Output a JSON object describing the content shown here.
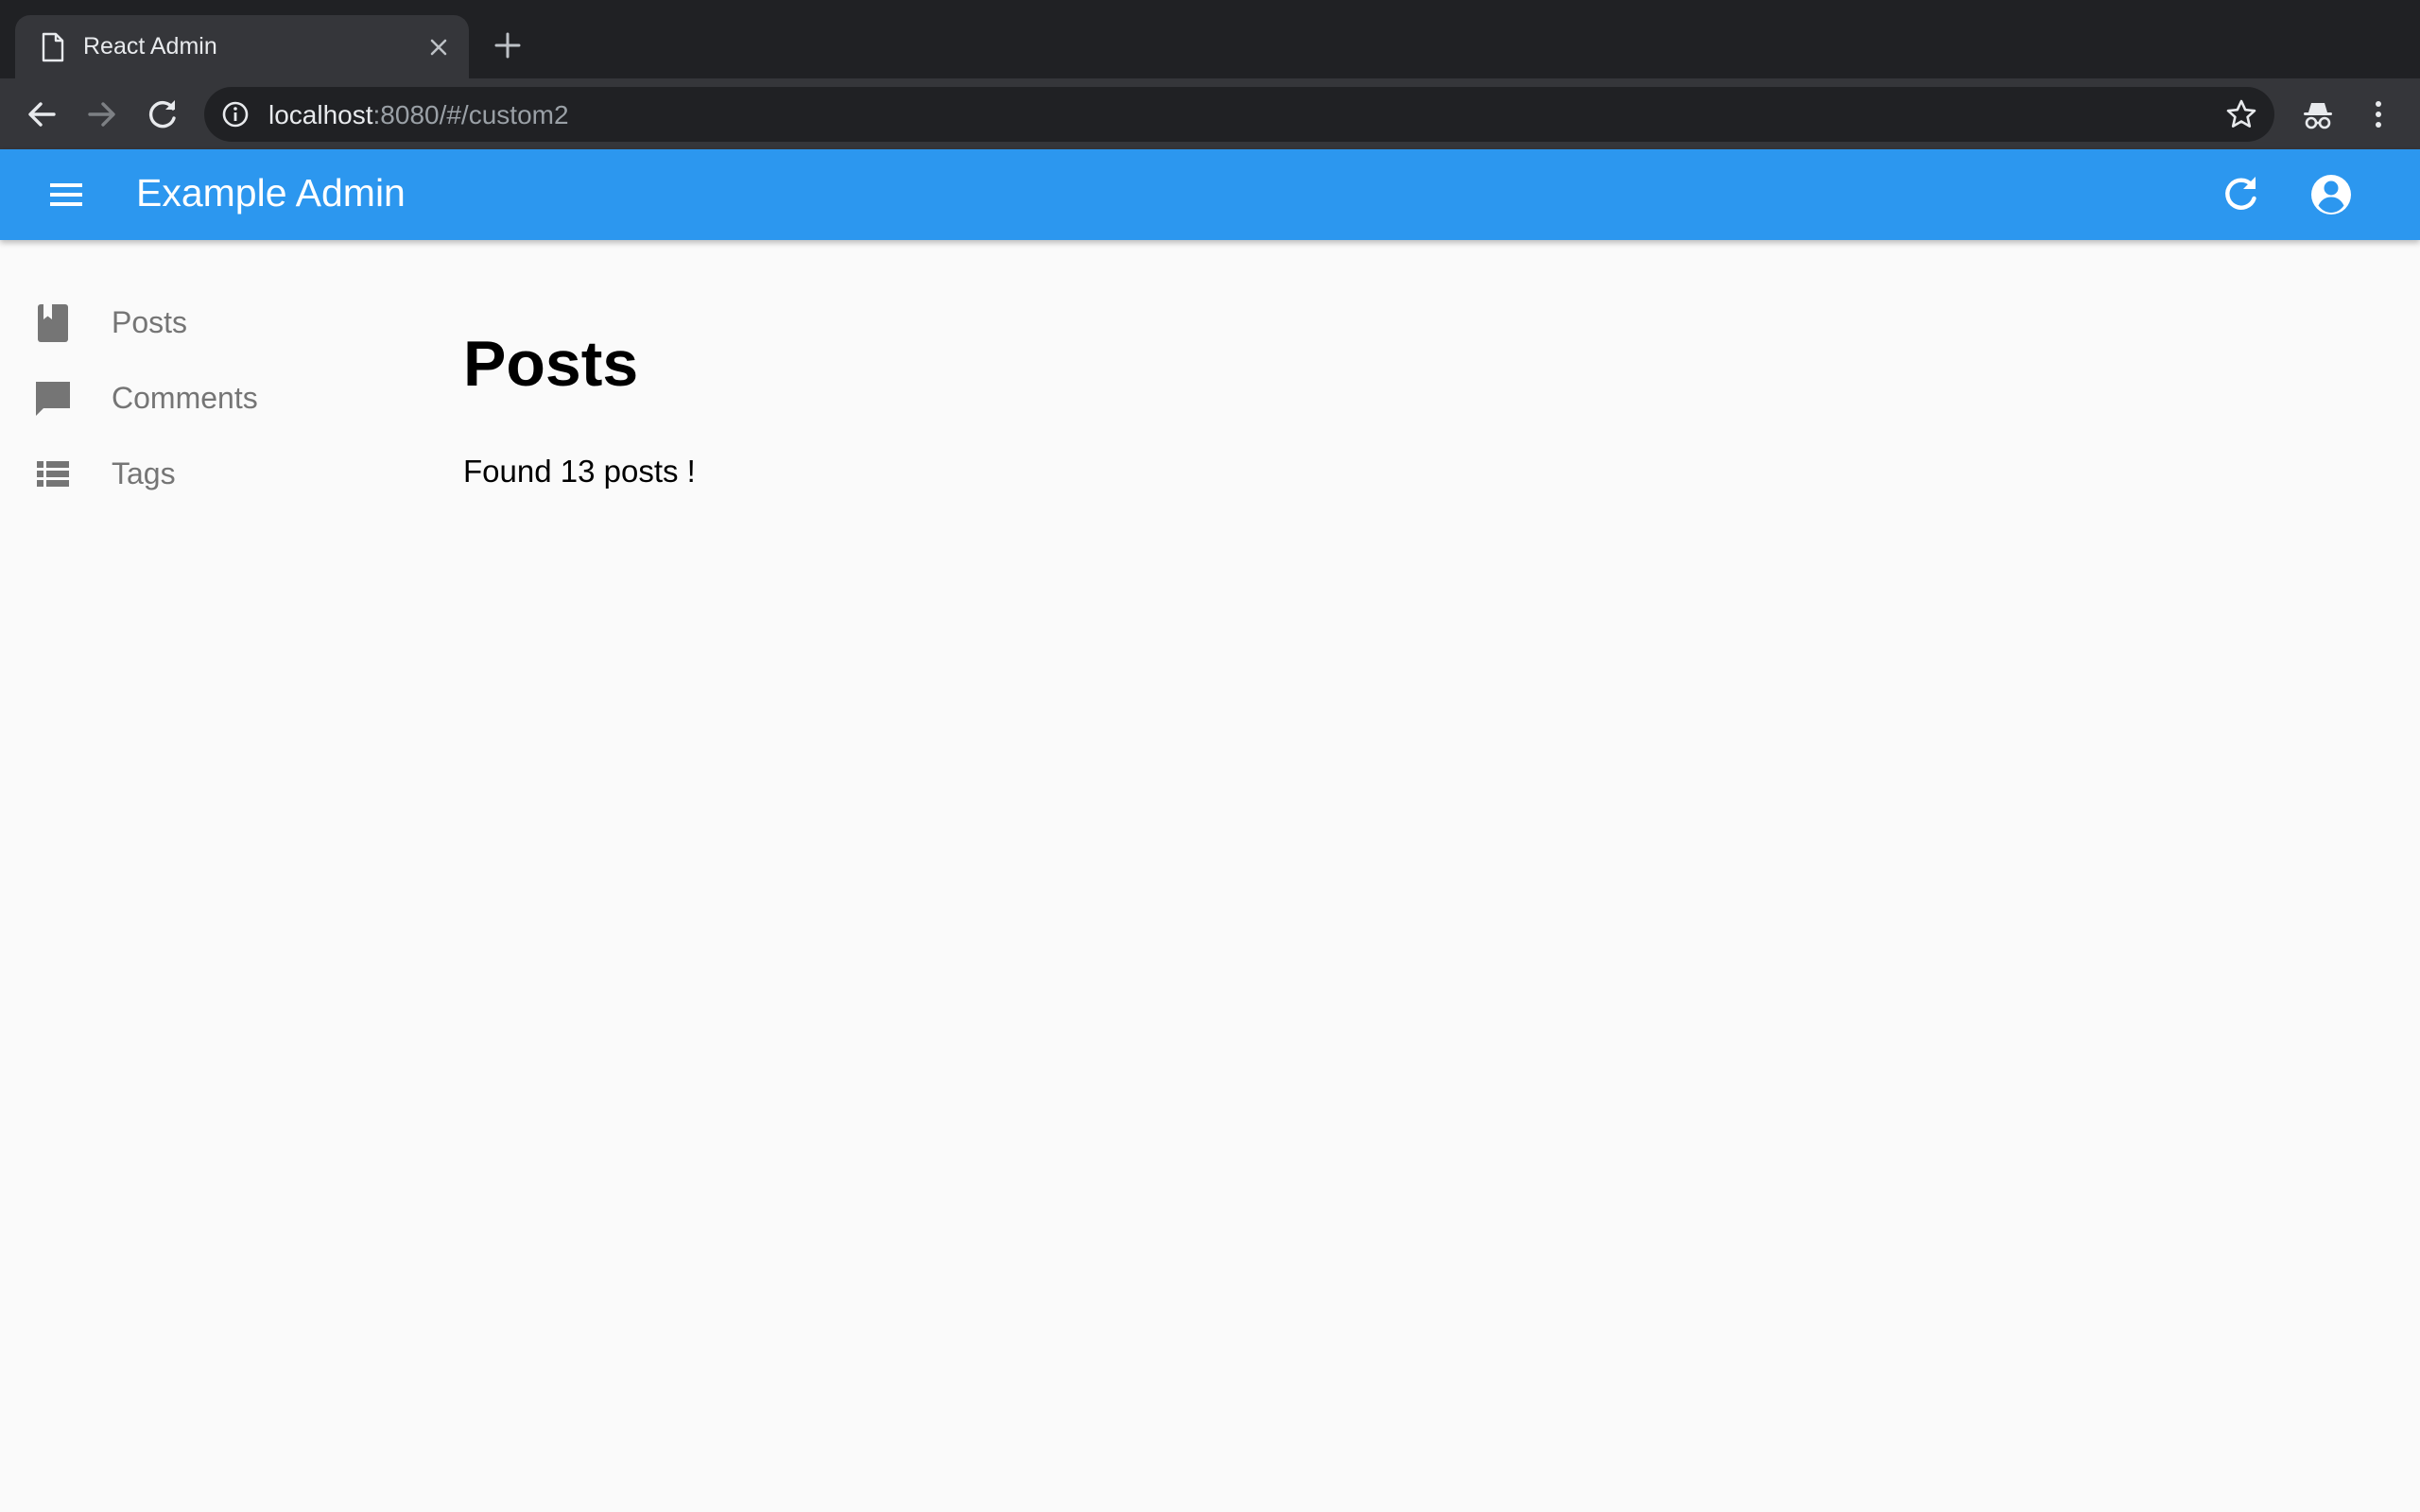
{
  "browser": {
    "tab_title": "React Admin",
    "url_host": "localhost",
    "url_path": ":8080/#/custom2",
    "icons": {
      "favicon": "page-icon",
      "tab_close": "close-icon",
      "new_tab": "plus-icon",
      "back": "arrow-left-icon",
      "forward": "arrow-right-icon",
      "reload": "reload-icon",
      "site_info": "info-icon",
      "bookmark": "star-icon",
      "incognito": "incognito-icon",
      "menu": "kebab-menu-icon"
    }
  },
  "appbar": {
    "title": "Example Admin",
    "color": "#2c97ef",
    "icons": {
      "menu": "hamburger-icon",
      "refresh": "refresh-icon",
      "account": "account-circle-icon"
    }
  },
  "sidebar": {
    "items": [
      {
        "label": "Posts",
        "icon": "book-icon"
      },
      {
        "label": "Comments",
        "icon": "comment-icon"
      },
      {
        "label": "Tags",
        "icon": "list-icon"
      }
    ]
  },
  "main": {
    "title": "Posts",
    "message": "Found 13 posts !"
  }
}
